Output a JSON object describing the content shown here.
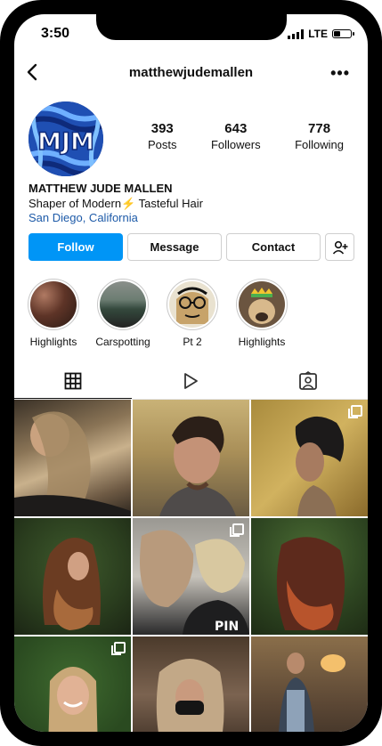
{
  "status": {
    "time": "3:50",
    "network": "LTE"
  },
  "header": {
    "username": "matthewjudemallen"
  },
  "profile": {
    "avatar_text": "MJM",
    "stats": [
      {
        "value": "393",
        "label": "Posts"
      },
      {
        "value": "643",
        "label": "Followers"
      },
      {
        "value": "778",
        "label": "Following"
      }
    ],
    "name": "MATTHEW JUDE MALLEN",
    "bio_before": "Shaper of Modern",
    "bio_emoji": "⚡",
    "bio_after": "Tasteful Hair",
    "location": "San Diego, California"
  },
  "buttons": {
    "follow": "Follow",
    "message": "Message",
    "contact": "Contact"
  },
  "highlights": [
    {
      "label": "Highlights"
    },
    {
      "label": "Carspotting"
    },
    {
      "label": "Pt 2"
    },
    {
      "label": "Highlights"
    }
  ],
  "colors": {
    "accent": "#0095f6",
    "link": "#1d5aa8"
  },
  "icons": {
    "back": "chevron-left-icon",
    "more": "more-horizontal-icon",
    "grid": "grid-icon",
    "reels": "play-icon",
    "tagged": "tagged-person-icon",
    "add_user": "add-user-icon"
  }
}
